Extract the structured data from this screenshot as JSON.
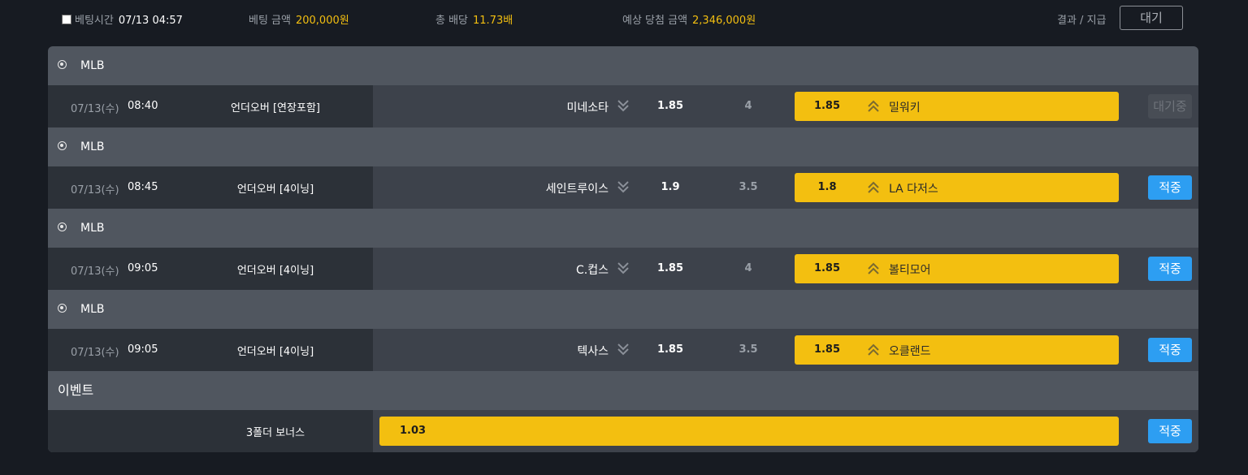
{
  "bet_summary": {
    "bet_time_label": "베팅시간",
    "bet_time": "07/13 04:57",
    "bet_amount_label": "베팅 금액",
    "bet_amount": "200,000원",
    "total_odds_label": "총 배당",
    "total_odds": "11.73배",
    "expected_win_label": "예상 당첨 금액",
    "expected_win": "2,346,000원",
    "result_label": "결과 / 지급",
    "status_button": "대기"
  },
  "bets": [
    {
      "league": "MLB",
      "date": "07/13(수)",
      "time": "08:40",
      "market": "언더오버 [연장포함]",
      "home_team": "미네소타",
      "home_odds": "1.85",
      "line": "4",
      "away_odds": "1.85",
      "away_team": "밀워키",
      "result": "대기중",
      "selected": "away"
    },
    {
      "league": "MLB",
      "date": "07/13(수)",
      "time": "08:45",
      "market": "언더오버 [4이닝]",
      "home_team": "세인트루이스",
      "home_odds": "1.9",
      "line": "3.5",
      "away_odds": "1.8",
      "away_team": "LA 다저스",
      "result": "적중",
      "selected": "away"
    },
    {
      "league": "MLB",
      "date": "07/13(수)",
      "time": "09:05",
      "market": "언더오버 [4이닝]",
      "home_team": "C.컵스",
      "home_odds": "1.85",
      "line": "4",
      "away_odds": "1.85",
      "away_team": "볼티모어",
      "result": "적중",
      "selected": "away"
    },
    {
      "league": "MLB",
      "date": "07/13(수)",
      "time": "09:05",
      "market": "언더오버 [4이닝]",
      "home_team": "텍사스",
      "home_odds": "1.85",
      "line": "3.5",
      "away_odds": "1.85",
      "away_team": "오클랜드",
      "result": "적중",
      "selected": "away"
    }
  ],
  "event": {
    "title": "이벤트",
    "label": "3폴더 보너스",
    "odds": "1.03",
    "result": "적중"
  },
  "colors": {
    "accent_yellow": "#f3bf10",
    "hit_blue": "#2d9ef2",
    "background": "#171b22"
  },
  "icons": {
    "league": "baseball-icon",
    "under": "double-chevron-down-icon",
    "over": "double-chevron-up-icon"
  }
}
